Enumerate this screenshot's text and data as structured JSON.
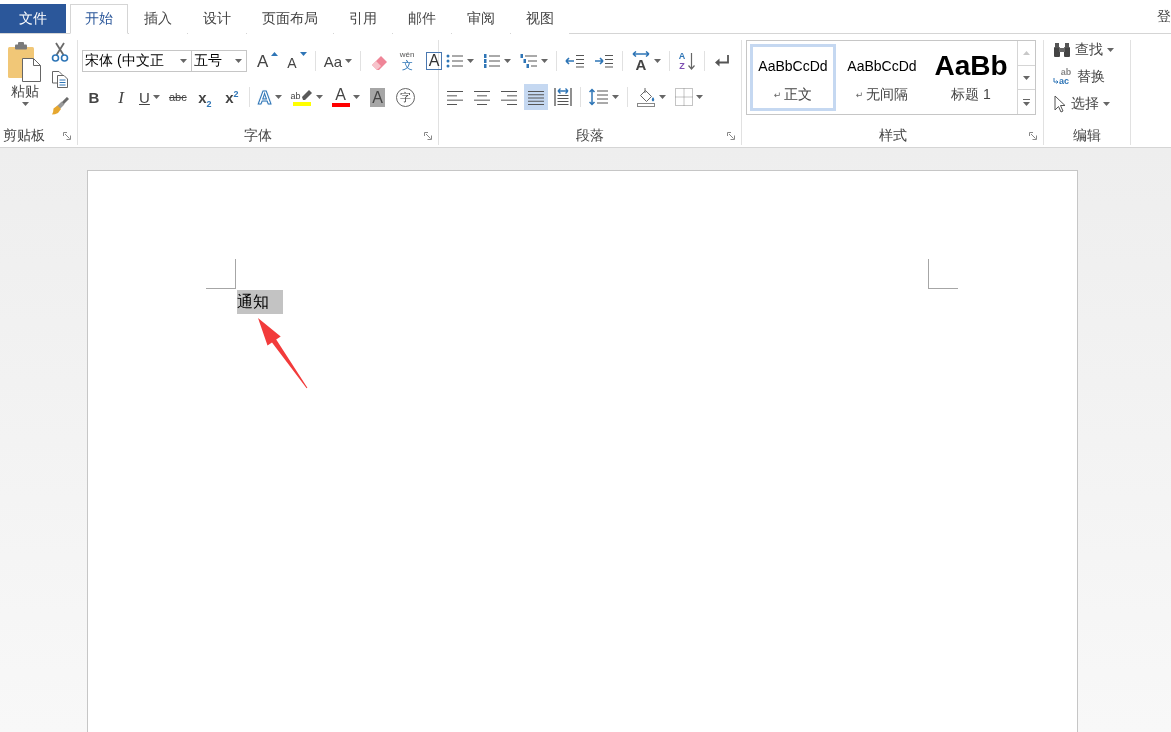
{
  "tabs": [
    {
      "label": "文件",
      "kind": "file",
      "selected": false
    },
    {
      "label": "开始",
      "kind": "tab",
      "selected": true
    },
    {
      "label": "插入",
      "kind": "tab",
      "selected": false
    },
    {
      "label": "设计",
      "kind": "tab",
      "selected": false
    },
    {
      "label": "页面布局",
      "kind": "tab",
      "selected": false
    },
    {
      "label": "引用",
      "kind": "tab",
      "selected": false
    },
    {
      "label": "邮件",
      "kind": "tab",
      "selected": false
    },
    {
      "label": "审阅",
      "kind": "tab",
      "selected": false
    },
    {
      "label": "视图",
      "kind": "tab",
      "selected": false
    }
  ],
  "account": {
    "label": "登"
  },
  "clipboard": {
    "title": "剪贴板",
    "launcher": true,
    "paste": {
      "label": "粘贴",
      "dropdown": true
    },
    "tools": [
      {
        "kind": "cut"
      },
      {
        "kind": "copy"
      },
      {
        "kind": "format_painter"
      }
    ]
  },
  "font": {
    "title": "字体",
    "launcher": true,
    "name_field": {
      "value": "宋体 (中文正"
    },
    "size_field": {
      "value": "五号"
    },
    "rows": [
      {
        "clusters": [
          {
            "tools": [
              {
                "kind": "grow",
                "glyph": "A",
                "dropdown": false
              },
              {
                "kind": "shrink",
                "glyph": "A",
                "dropdown": false
              }
            ]
          },
          {
            "tools": [
              {
                "kind": "change_case",
                "glyph": "Aa",
                "dropdown": true
              }
            ]
          },
          {
            "tools": [
              {
                "kind": "clear",
                "dropdown": false
              },
              {
                "kind": "phonetic",
                "ruby": "wén",
                "glyph": "文",
                "dropdown": false
              },
              {
                "kind": "char_border",
                "glyph": "A",
                "dropdown": false
              }
            ]
          }
        ]
      },
      {
        "clusters": [
          {
            "tools": [
              {
                "kind": "bold",
                "glyph": "B",
                "dropdown": false
              },
              {
                "kind": "italic",
                "glyph": "I",
                "dropdown": false
              },
              {
                "kind": "underline",
                "glyph": "U",
                "dropdown": true
              },
              {
                "kind": "strike",
                "glyph": "abc",
                "dropdown": false
              },
              {
                "kind": "subscript",
                "glyph": "x$_{2}$",
                "dropdown": false
              },
              {
                "kind": "superscript",
                "glyph": "x$^{2}$",
                "dropdown": false
              }
            ]
          },
          {
            "tools": [
              {
                "kind": "effects",
                "glyph": "A",
                "dropdown": true
              },
              {
                "kind": "highlight",
                "glyph": "ab",
                "color": "#ffff00",
                "dropdown": true
              },
              {
                "kind": "font_color",
                "glyph": "A",
                "color": "#ff0000",
                "dropdown": true
              },
              {
                "kind": "char_shading",
                "glyph": "A",
                "dropdown": false
              },
              {
                "kind": "enclose",
                "glyph": "字",
                "dropdown": false
              }
            ]
          }
        ]
      }
    ]
  },
  "paragraph": {
    "title": "段落",
    "launcher": true,
    "rows": [
      {
        "clusters": [
          {
            "tools": [
              {
                "kind": "bullets",
                "dropdown": true
              },
              {
                "kind": "numbering",
                "dropdown": true
              },
              {
                "kind": "multilevel",
                "dropdown": true
              }
            ]
          },
          {
            "tools": [
              {
                "kind": "decrease_indent",
                "dropdown": false
              },
              {
                "kind": "increase_indent",
                "dropdown": false
              }
            ]
          },
          {
            "tools": [
              {
                "kind": "asian_layout",
                "glyph": "A",
                "dropdown": true
              }
            ]
          },
          {
            "tools": [
              {
                "kind": "sort",
                "glyph": "A",
                "glyph_2": "Z",
                "dropdown": false
              }
            ]
          },
          {
            "tools": [
              {
                "kind": "show_marks",
                "dropdown": false
              }
            ]
          }
        ]
      },
      {
        "clusters": [
          {
            "tools": [
              {
                "kind": "align_left",
                "selected": false,
                "dropdown": false
              },
              {
                "kind": "align_center",
                "selected": false,
                "dropdown": false
              },
              {
                "kind": "align_right",
                "selected": false,
                "dropdown": false
              },
              {
                "kind": "justify",
                "selected": true,
                "dropdown": false
              },
              {
                "kind": "distribute",
                "selected": false,
                "dropdown": false
              }
            ]
          },
          {
            "tools": [
              {
                "kind": "line_spacing",
                "dropdown": true
              }
            ]
          },
          {
            "tools": [
              {
                "kind": "shading",
                "dropdown": true
              },
              {
                "kind": "borders",
                "dropdown": true
              }
            ]
          }
        ]
      }
    ]
  },
  "styles": {
    "title": "样式",
    "launcher": true,
    "items": [
      {
        "kind": "body",
        "preview": "AaBbCcDd",
        "mark": "↵",
        "name": "正文",
        "selected": true
      },
      {
        "kind": "body",
        "preview": "AaBbCcDd",
        "mark": "↵",
        "name": "无间隔",
        "selected": false
      },
      {
        "kind": "heading",
        "preview": "AaBb",
        "name": "标题 1",
        "selected": false
      }
    ],
    "scroll": [
      {
        "kind": "up",
        "disabled": true
      },
      {
        "kind": "down",
        "disabled": false
      },
      {
        "kind": "more",
        "disabled": false
      }
    ]
  },
  "editing": {
    "title": "编辑",
    "launcher": false,
    "items": [
      {
        "kind": "find",
        "label": "查找",
        "dropdown": true
      },
      {
        "kind": "replace",
        "label": "替换",
        "icon_text": [
          "ab",
          "ac"
        ],
        "dropdown": false
      },
      {
        "kind": "select",
        "label": "选择",
        "dropdown": true
      }
    ]
  },
  "document": {
    "paragraphs": [
      {
        "text": "通知",
        "selected": true
      }
    ]
  }
}
